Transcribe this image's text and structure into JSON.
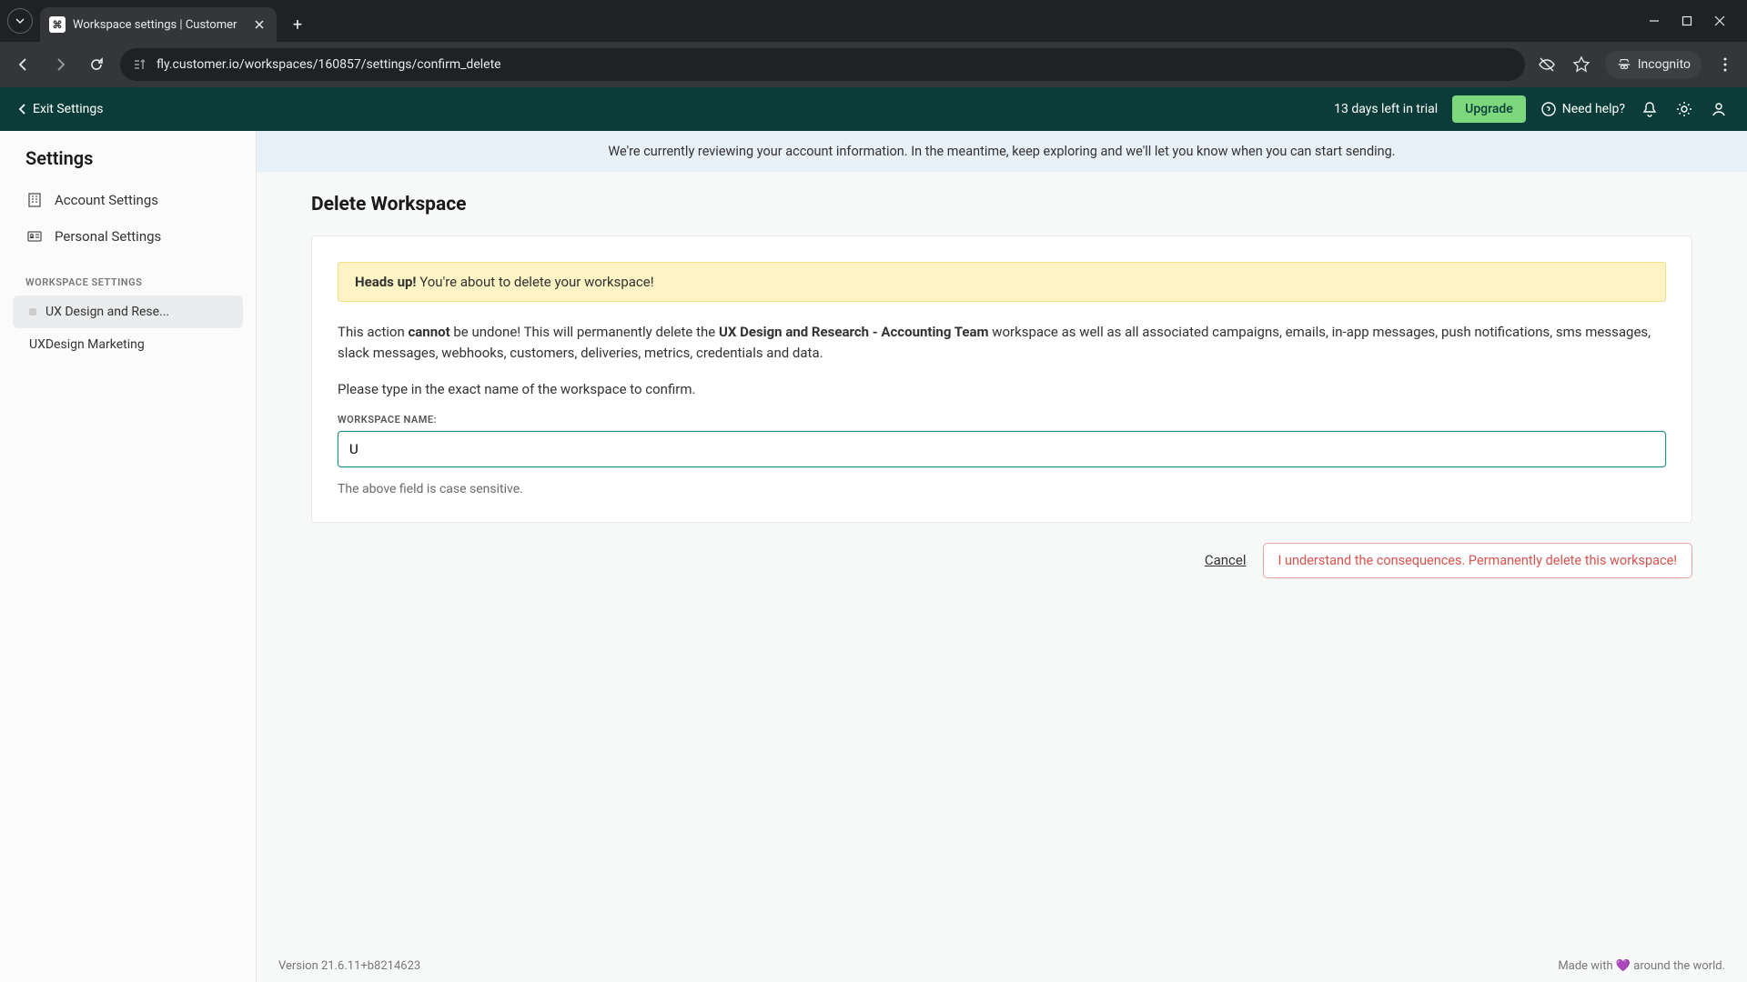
{
  "browser": {
    "tab_title": "Workspace settings | Customer",
    "url": "fly.customer.io/workspaces/160857/settings/confirm_delete",
    "incognito_label": "Incognito"
  },
  "topbar": {
    "exit_label": "Exit Settings",
    "trial_text": "13 days left in trial",
    "upgrade_label": "Upgrade",
    "help_label": "Need help?"
  },
  "sidebar": {
    "title": "Settings",
    "account_label": "Account Settings",
    "personal_label": "Personal Settings",
    "section_label": "WORKSPACE SETTINGS",
    "workspaces": [
      {
        "label": "UX Design and Rese...",
        "active": true
      },
      {
        "label": "UXDesign Marketing",
        "active": false
      }
    ]
  },
  "banner": {
    "review_text": "We're currently reviewing your account information. In the meantime, keep exploring and we'll let you know when you can start sending."
  },
  "page": {
    "title": "Delete Workspace",
    "alert_strong": "Heads up!",
    "alert_text": " You're about to delete your workspace!",
    "warn_pre": "This action ",
    "warn_cannot": "cannot",
    "warn_mid": " be undone! This will permanently delete the ",
    "warn_name": "UX Design and Research - Accounting Team",
    "warn_post": " workspace as well as all associated campaigns, emails, in-app messages, push notifications, sms messages, slack messages, webhooks, customers, deliveries, metrics, credentials and data.",
    "confirm_prompt": "Please type in the exact name of the workspace to confirm.",
    "field_label": "WORKSPACE NAME:",
    "input_value": "U",
    "hint": "The above field is case sensitive.",
    "cancel_label": "Cancel",
    "delete_label": "I understand the consequences. Permanently delete this workspace!"
  },
  "footer": {
    "version": "Version 21.6.11+b8214623",
    "made_pre": "Made with ",
    "made_post": " around the world."
  }
}
